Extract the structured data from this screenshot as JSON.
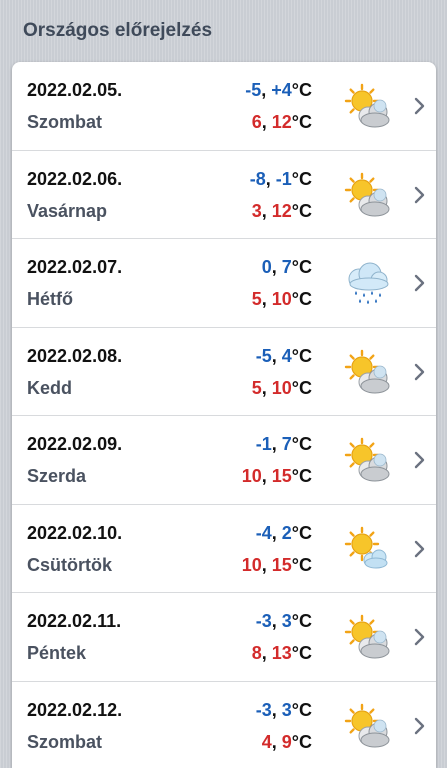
{
  "header": {
    "title": "Országos előrejelzés"
  },
  "rows": [
    {
      "date": "2022.02.05.",
      "day": "Szombat",
      "min_a": "-5",
      "min_b": "+4",
      "max_a": "6",
      "max_b": "12",
      "unit": "°C",
      "icon": "partly-cloudy-icon"
    },
    {
      "date": "2022.02.06.",
      "day": "Vasárnap",
      "min_a": "-8",
      "min_b": "-1",
      "max_a": "3",
      "max_b": "12",
      "unit": "°C",
      "icon": "partly-cloudy-icon"
    },
    {
      "date": "2022.02.07.",
      "day": "Hétfő",
      "min_a": "0",
      "min_b": "7",
      "max_a": "5",
      "max_b": "10",
      "unit": "°C",
      "icon": "rain-icon"
    },
    {
      "date": "2022.02.08.",
      "day": "Kedd",
      "min_a": "-5",
      "min_b": "4",
      "max_a": "5",
      "max_b": "10",
      "unit": "°C",
      "icon": "partly-cloudy-icon"
    },
    {
      "date": "2022.02.09.",
      "day": "Szerda",
      "min_a": "-1",
      "min_b": "7",
      "max_a": "10",
      "max_b": "15",
      "unit": "°C",
      "icon": "partly-cloudy-icon"
    },
    {
      "date": "2022.02.10.",
      "day": "Csütörtök",
      "min_a": "-4",
      "min_b": "2",
      "max_a": "10",
      "max_b": "15",
      "unit": "°C",
      "icon": "mostly-sunny-icon"
    },
    {
      "date": "2022.02.11.",
      "day": "Péntek",
      "min_a": "-3",
      "min_b": "3",
      "max_a": "8",
      "max_b": "13",
      "unit": "°C",
      "icon": "partly-cloudy-icon"
    },
    {
      "date": "2022.02.12.",
      "day": "Szombat",
      "min_a": "-3",
      "min_b": "3",
      "max_a": "4",
      "max_b": "9",
      "unit": "°C",
      "icon": "partly-cloudy-icon"
    }
  ],
  "colors": {
    "min": "#1b5fb8",
    "max": "#d32b2b",
    "text": "#111111",
    "day": "#4a5260"
  }
}
